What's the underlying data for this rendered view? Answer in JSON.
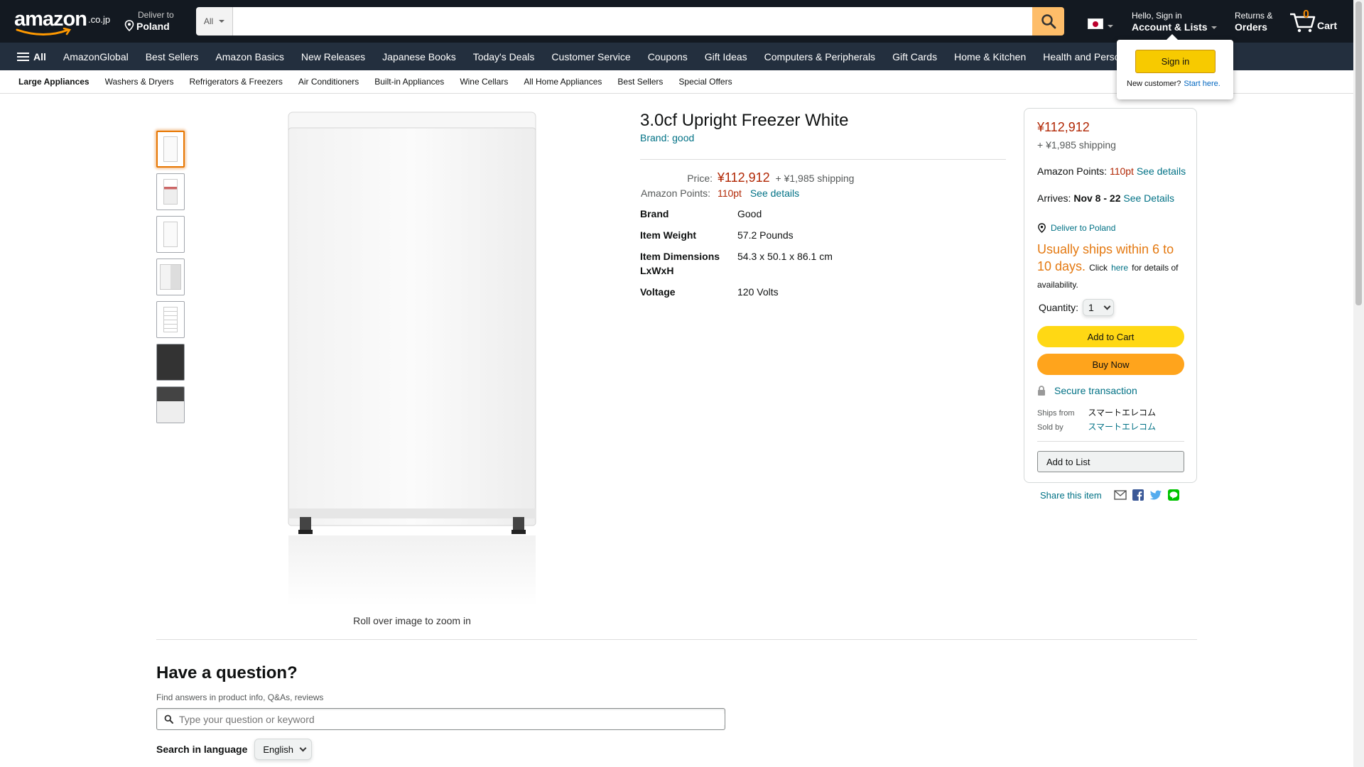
{
  "header": {
    "logo_word": "amazon",
    "logo_tld": ".co.jp",
    "deliver_line1": "Deliver to",
    "deliver_line2": "Poland",
    "search_category": "All",
    "search_placeholder": "",
    "account_line1": "Hello, Sign in",
    "account_line2": "Account & Lists",
    "returns_line1": "Returns &",
    "returns_line2": "Orders",
    "cart_count": "0",
    "cart_label": "Cart",
    "flag_icon": "japan-flag-icon"
  },
  "nav": {
    "all_label": "All",
    "items": [
      "AmazonGlobal",
      "Best Sellers",
      "Amazon Basics",
      "New Releases",
      "Japanese Books",
      "Today's Deals",
      "Customer Service",
      "Coupons",
      "Gift Ideas",
      "Computers & Peripherals",
      "Gift Cards",
      "Home & Kitchen",
      "Health and Personal Care"
    ]
  },
  "subnav": {
    "items": [
      "Large Appliances",
      "Washers & Dryers",
      "Refrigerators & Freezers",
      "Air Conditioners",
      "Built-in Appliances",
      "Wine Cellars",
      "All Home Appliances",
      "Best Sellers",
      "Special Offers"
    ]
  },
  "signin_flyout": {
    "button": "Sign in",
    "new_customer": "New customer?",
    "start_here": "Start here."
  },
  "gallery": {
    "thumbnail_count": 7,
    "active_index": 0,
    "zoom_note": "Roll over image to zoom in"
  },
  "product": {
    "title": "3.0cf Upright Freezer White",
    "brand_link": "Brand: good",
    "price_label": "Price:",
    "price": "¥112,912",
    "shipping": "+ ¥1,985 shipping",
    "points_label": "Amazon Points:",
    "points": "110pt",
    "points_link": "See details",
    "specs": [
      {
        "key": "Brand",
        "value": "Good"
      },
      {
        "key": "Item Weight",
        "value": "57.2 Pounds"
      },
      {
        "key": "Item Dimensions LxWxH",
        "value": "54.3 x 50.1 x 86.1 cm"
      },
      {
        "key": "Voltage",
        "value": "120 Volts"
      }
    ]
  },
  "buybox": {
    "price": "¥112,912",
    "shipping": "+ ¥1,985 shipping",
    "points_label": "Amazon Points:",
    "points": "110pt",
    "points_link": "See details",
    "arrives_label": "Arrives:",
    "arrives_dates": "Nov 8 - 22",
    "arrives_link": "See Details",
    "deliver_to": "Deliver to Poland",
    "stock_main": "Usually ships within 6 to 10 days.",
    "stock_click": "Click",
    "stock_here": "here",
    "stock_rest": "for details of availability.",
    "quantity_label": "Quantity:",
    "quantity_value": "1",
    "add_to_cart": "Add to Cart",
    "buy_now": "Buy Now",
    "secure": "Secure transaction",
    "ships_from_label": "Ships from",
    "ships_from_value": "スマートエレコム",
    "sold_by_label": "Sold by",
    "sold_by_value": "スマートエレコム",
    "add_to_list": "Add to List"
  },
  "share": {
    "label": "Share this item",
    "icons": [
      "email-icon",
      "facebook-icon",
      "twitter-icon",
      "line-icon"
    ]
  },
  "questions": {
    "title": "Have a question?",
    "subtitle": "Find answers in product info, Q&As, reviews",
    "input_placeholder": "Type your question or keyword",
    "language_label": "Search in language",
    "language_value": "English"
  },
  "colors": {
    "nav_dark": "#131921",
    "nav_secondary": "#232f3e",
    "price_red": "#b12704",
    "link_teal": "#007185",
    "cart_yellow": "#ffd814",
    "buy_orange": "#ffa41c",
    "stock_orange": "#e47911"
  }
}
